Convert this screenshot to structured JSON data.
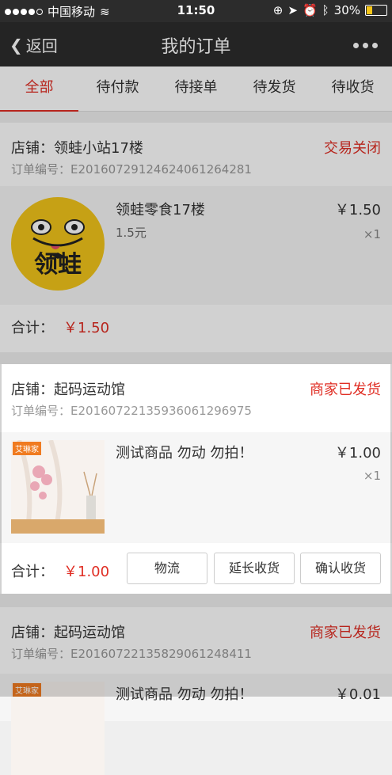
{
  "status_bar": {
    "carrier": "中国移动",
    "time": "11:50",
    "battery": "30%",
    "battery_level": 0.3
  },
  "nav": {
    "back": "返回",
    "title": "我的订单"
  },
  "tabs": [
    "全部",
    "待付款",
    "待接单",
    "待发货",
    "待收货"
  ],
  "orders": [
    {
      "shop": "店铺：领蛙小站17楼",
      "status": "交易关闭",
      "order_no": "订单编号：E20160729124624061264281",
      "item": {
        "name": "领蛙零食17楼",
        "desc": "1.5元",
        "price": "￥1.50",
        "qty": "×1",
        "logo_text": "领蛙"
      },
      "total_label": "合计：",
      "total": "￥1.50"
    },
    {
      "shop": "店铺：起码运动馆",
      "status": "商家已发货",
      "order_no": "订单编号：E20160722135936061296975",
      "item": {
        "name": "测试商品 勿动 勿拍！",
        "price": "￥1.00",
        "qty": "×1",
        "badge": "艾琳家"
      },
      "total_label": "合计：",
      "total": "￥1.00",
      "buttons": [
        "物流",
        "延长收货",
        "确认收货"
      ]
    },
    {
      "shop": "店铺：起码运动馆",
      "status": "商家已发货",
      "order_no": "订单编号：E20160722135829061248411",
      "item": {
        "name": "测试商品 勿动 勿拍！",
        "price": "￥0.01",
        "badge": "艾琳家"
      }
    }
  ]
}
